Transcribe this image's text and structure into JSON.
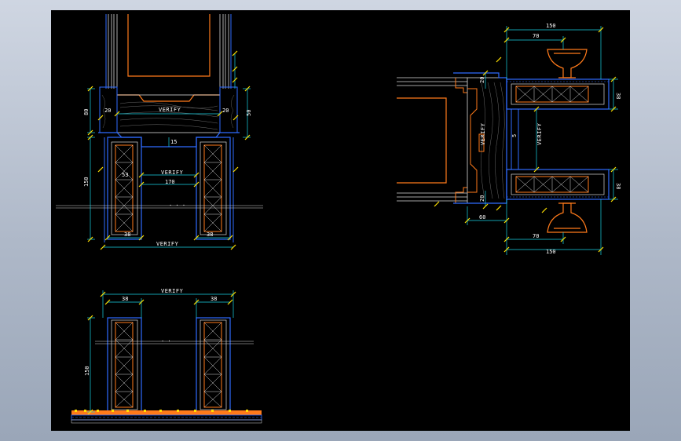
{
  "drawing": {
    "left_elevation": {
      "dims": {
        "top_gap_a": "20",
        "top_gap_b": "20",
        "rail_height_left": "80",
        "rail_height_right": "50",
        "rail_label": "VERIFY",
        "small_gap": "15",
        "inner_a": "53",
        "mid_label": "VERIFY",
        "span": "170",
        "post_height": "150",
        "post_w_left": "38",
        "post_w_right": "38",
        "bottom_label": "VERIFY"
      }
    },
    "right_section": {
      "dims": {
        "top_overall": "150",
        "top_inner": "70",
        "right_top": "38",
        "vert_20_top": "20",
        "vert_5": "5",
        "mid_label": "VERIFY",
        "left_label": "VERIFY",
        "vert_20_bottom": "20",
        "right_bottom": "38",
        "bottom_60": "60",
        "bottom_inner": "70",
        "bottom_overall": "150"
      }
    },
    "lower_elevation": {
      "dims": {
        "top_label": "VERIFY",
        "post_w_left": "38",
        "post_w_right": "38",
        "post_height": "150"
      }
    }
  }
}
